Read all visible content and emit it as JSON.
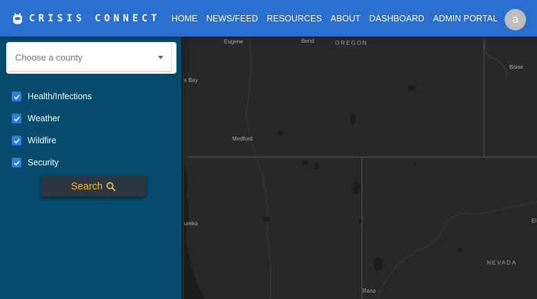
{
  "app": {
    "brand": "CRISIS CONNECT",
    "brand_icon": "shield-icon",
    "accent_color": "#2a6fd0"
  },
  "nav": {
    "items": [
      {
        "label": "HOME"
      },
      {
        "label": "NEWS/FEED"
      },
      {
        "label": "RESOURCES"
      },
      {
        "label": "ABOUT"
      },
      {
        "label": "DASHBOARD"
      },
      {
        "label": "ADMIN PORTAL"
      }
    ]
  },
  "user": {
    "avatar_initial": "a"
  },
  "sidebar": {
    "county_select": {
      "placeholder": "Choose a county",
      "value": ""
    },
    "filters": [
      {
        "label": "Health/Infections",
        "checked": true
      },
      {
        "label": "Weather",
        "checked": true
      },
      {
        "label": "Wildfire",
        "checked": true
      },
      {
        "label": "Security",
        "checked": true
      }
    ],
    "search_button": {
      "label": "Search",
      "icon": "search-icon",
      "color": "#f5b92a"
    }
  },
  "map": {
    "labels": {
      "eugene": "Eugene",
      "bend": "Bend",
      "oregon": "OREGON",
      "coos_bay": "s Bay",
      "boise": "Boise",
      "medford": "Medford",
      "eureka": "ureka",
      "nevada": "NEVADA",
      "reno": "Reno",
      "elko": "El"
    }
  }
}
